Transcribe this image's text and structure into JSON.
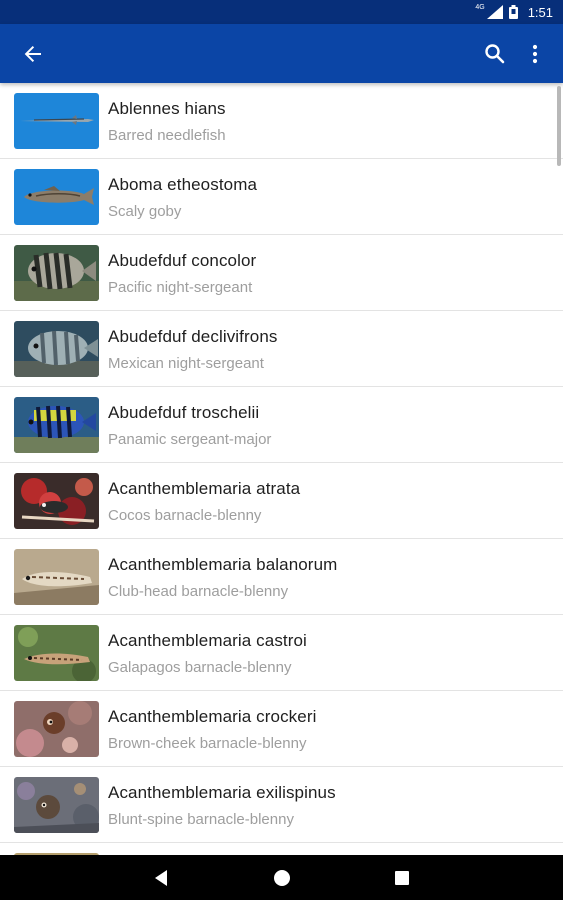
{
  "status_bar": {
    "time": "1:51",
    "network_type": "4G",
    "icons": [
      "signal-icon",
      "battery-icon"
    ]
  },
  "app_bar": {
    "background": "#0b45a6",
    "icons": [
      "back-arrow-icon",
      "search-icon",
      "more-vert-icon"
    ]
  },
  "species": [
    {
      "scientific": "Ablennes hians",
      "common": "Barred needlefish",
      "thumb": "needlefish"
    },
    {
      "scientific": "Aboma etheostoma",
      "common": "Scaly goby",
      "thumb": "goby"
    },
    {
      "scientific": "Abudefduf concolor",
      "common": "Pacific night-sergeant",
      "thumb": "sergeant-dark"
    },
    {
      "scientific": "Abudefduf declivifrons",
      "common": "Mexican night-sergeant",
      "thumb": "sergeant-grey"
    },
    {
      "scientific": "Abudefduf troschelii",
      "common": "Panamic sergeant-major",
      "thumb": "sergeant-major"
    },
    {
      "scientific": "Acanthemblemaria atrata",
      "common": "Cocos barnacle-blenny",
      "thumb": "blenny-red"
    },
    {
      "scientific": "Acanthemblemaria balanorum",
      "common": "Club-head barnacle-blenny",
      "thumb": "blenny-sand"
    },
    {
      "scientific": "Acanthemblemaria castroi",
      "common": "Galapagos barnacle-blenny",
      "thumb": "blenny-green"
    },
    {
      "scientific": "Acanthemblemaria crockeri",
      "common": "Brown-cheek barnacle-blenny",
      "thumb": "blenny-pink"
    },
    {
      "scientific": "Acanthemblemaria exilispinus",
      "common": "Blunt-spine barnacle-blenny",
      "thumb": "blenny-rock"
    }
  ],
  "nav_bar": {
    "icons": [
      "nav-back-icon",
      "nav-home-icon",
      "nav-recents-icon"
    ]
  }
}
